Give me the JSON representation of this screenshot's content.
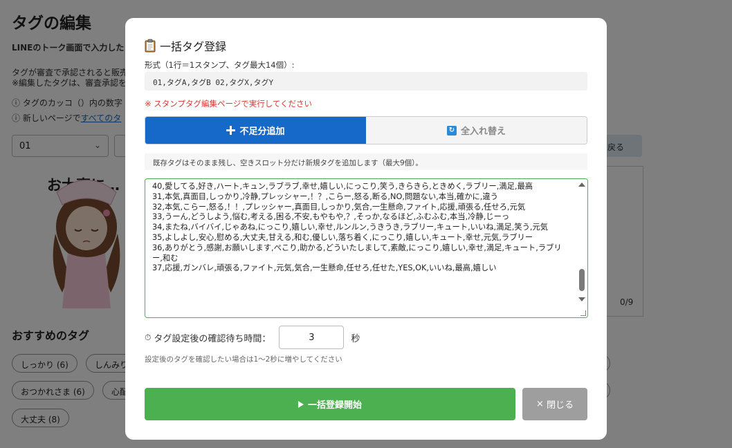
{
  "background": {
    "title": "タグの編集",
    "intro_bold": "LINEのトーク画面で入力した",
    "desc_line1": "タグが審査で承認されると販売",
    "desc_line2": "※編集したタグは、審査承認を",
    "note1": "ⓘ タグのカッコ（）内の数字",
    "note2_prefix": "ⓘ 新しいページで",
    "note2_link": "すべてのタ",
    "sticker_select_value": "01",
    "back_label": "戻る",
    "sticker_title": "お大事に…",
    "tag_counter": "0/9",
    "recommended_heading": "おすすめのタグ",
    "recommended_tags": [
      "しっかり (6)",
      "しんみり",
      "おつかれさま (6)",
      "心配",
      "大丈夫 (8)"
    ]
  },
  "modal": {
    "title": "一括タグ登録",
    "title_icon": "clipboard-icon",
    "format_label": "形式（1行＝1スタンプ、タグ最大14個）:",
    "format_example": "01,タグA,タグB  02,タグX,タグY",
    "warning": "※ スタンプタグ編集ページで実行してください",
    "tabs": [
      {
        "label": "不足分追加",
        "icon": "plus-icon",
        "active": true
      },
      {
        "label": "全入れ替え",
        "icon": "swap-icon",
        "active": false
      }
    ],
    "mode_description": "既存タグはそのまま残し、空きスロット分だけ新規タグを追加します（最大9個）。",
    "textarea_lines": [
      "40,愛してる,好き,ハート,キュン,ラブラブ,幸せ,嬉しい,にっこり,笑う,きらきら,ときめく,ラブリー,満足,最高",
      "31,本気,真面目,しっかり,冷静,プレッシャー,！？,こらー,怒る,断る,NO,問題ない,本当,確かに,違う",
      "32,本気,こらー,怒る,！！,プレッシャー,真面目,しっかり,気合,一生懸命,ファイト,応援,頑張る,任せろ,元気",
      "33,うーん,どうしよう,悩む,考える,困る,不安,もやもや,？,そっか,なるほど,ふむふむ,本当,冷静,じーっ",
      "34,またね,バイバイ,じゃあね,にっこり,嬉しい,幸せ,ルンルン,うきうき,ラブリー,キュート,いいね,満足,笑う,元気",
      "35,よしよし,安心,慰める,大丈夫,甘える,和む,優しい,落ち着く,にっこり,嬉しい,キュート,幸せ,元気,ラブリー",
      "36,ありがとう,感謝,お願いします,ぺこり,助かる,どういたしまして,素敵,にっこり,嬉しい,幸せ,満足,キュート,ラブリー,和む",
      "37,応援,ガンバレ,頑張る,ファイト,元気,気合,一生懸命,任せろ,任せた,YES,OK,いいね,最高,嬉しい"
    ],
    "wait_label": "タグ設定後の確認待ち時間：",
    "wait_value": "3",
    "wait_unit": "秒",
    "wait_hint": "設定後のタグを確認したい場合は1〜2秒に増やしてください",
    "start_button": "一括登録開始",
    "close_button": "閉じる",
    "close_glyph": "×",
    "timer_glyph": "⏱",
    "swap_glyph": "↻",
    "accent_blue": "#1769c9",
    "accent_green": "#4caf50",
    "warning_red": "#d9382f"
  }
}
